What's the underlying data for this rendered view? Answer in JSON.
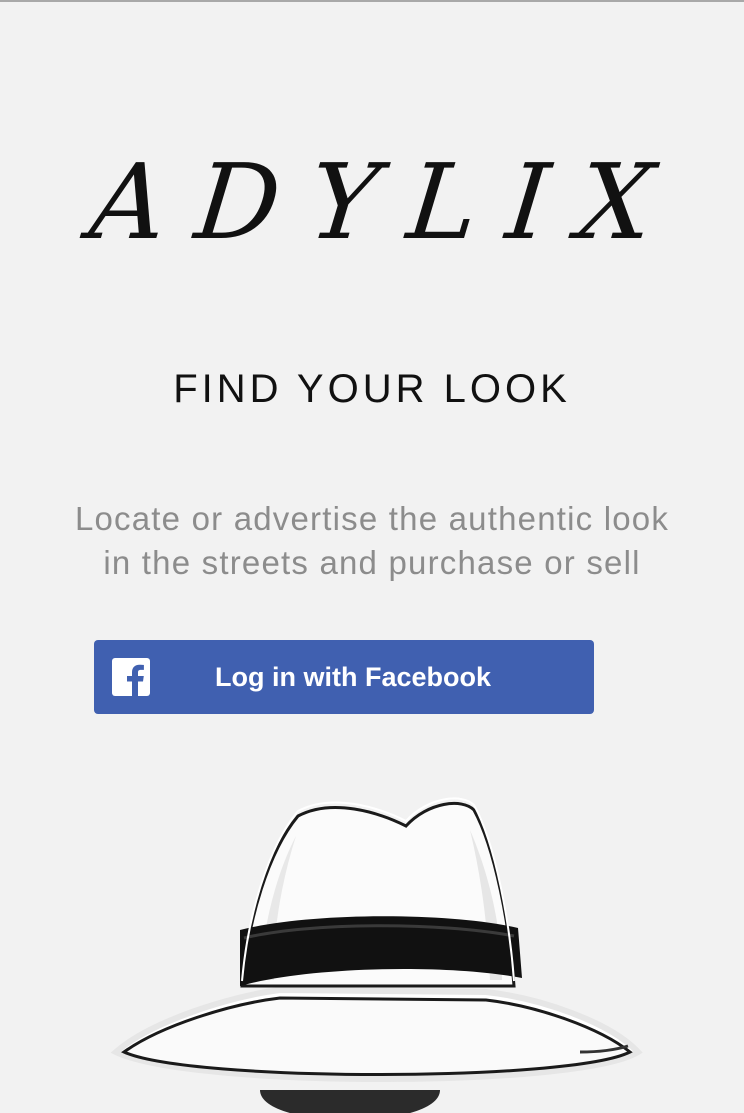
{
  "app": {
    "logo_text": "ADYLIX",
    "tagline": "FIND YOUR LOOK",
    "description": {
      "line1": "Locate or advertise the authentic look",
      "line2": "in the streets and purchase or sell"
    }
  },
  "login": {
    "facebook_label": "Log in with Facebook",
    "icon": "facebook-icon",
    "brand_color": "#4060b0"
  },
  "hero": {
    "icon": "hat-illustration"
  }
}
